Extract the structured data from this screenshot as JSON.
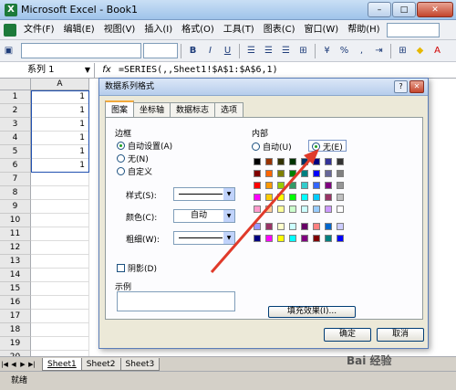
{
  "window": {
    "title": "Microsoft Excel - Book1",
    "logo": "X",
    "buttons": [
      "–",
      "□",
      "✕"
    ]
  },
  "menu": {
    "items": [
      "文件(F)",
      "编辑(E)",
      "视图(V)",
      "插入(I)",
      "格式(O)",
      "工具(T)",
      "图表(C)",
      "窗口(W)",
      "帮助(H)"
    ]
  },
  "toolbar": {
    "icons": [
      "save-icon",
      "bold-icon",
      "italic-icon",
      "underline-icon",
      "align-left-icon",
      "align-center-icon",
      "align-right-icon",
      "merge-icon",
      "currency-icon",
      "percent-icon",
      "comma-icon",
      "indent-icon",
      "border-icon",
      "fill-color-icon",
      "font-color-icon"
    ],
    "labels": [
      "B",
      "I",
      "U"
    ]
  },
  "formula_bar": {
    "name_box": "系列 1",
    "fx": "fx",
    "formula": "=SERIES(,,Sheet1!$A$1:$A$6,1)"
  },
  "sheet": {
    "column": "A",
    "rows": [
      {
        "n": "1",
        "a": "1"
      },
      {
        "n": "2",
        "a": "1"
      },
      {
        "n": "3",
        "a": "1"
      },
      {
        "n": "4",
        "a": "1"
      },
      {
        "n": "5",
        "a": "1"
      },
      {
        "n": "6",
        "a": "1"
      },
      {
        "n": "7",
        "a": ""
      },
      {
        "n": "8",
        "a": ""
      },
      {
        "n": "9",
        "a": ""
      },
      {
        "n": "10",
        "a": ""
      },
      {
        "n": "11",
        "a": ""
      },
      {
        "n": "12",
        "a": ""
      },
      {
        "n": "13",
        "a": ""
      },
      {
        "n": "14",
        "a": ""
      },
      {
        "n": "15",
        "a": ""
      },
      {
        "n": "16",
        "a": ""
      },
      {
        "n": "17",
        "a": ""
      },
      {
        "n": "18",
        "a": ""
      },
      {
        "n": "19",
        "a": ""
      },
      {
        "n": "20",
        "a": ""
      }
    ]
  },
  "sheet_tabs": [
    "Sheet1",
    "Sheet2",
    "Sheet3"
  ],
  "status": "就绪",
  "dialog": {
    "title": "数据系列格式",
    "help": "?",
    "close": "✕",
    "tabs": [
      "图案",
      "坐标轴",
      "数据标志",
      "选项"
    ],
    "border": {
      "label": "边框",
      "options": [
        "自动设置(A)",
        "无(N)",
        "自定义"
      ],
      "style_label": "样式(S):",
      "color_label": "颜色(C):",
      "color_value": "自动",
      "weight_label": "粗细(W):",
      "shadow_label": "阴影(D)",
      "sample_label": "示例"
    },
    "area": {
      "label": "内部",
      "options": [
        "自动(U)",
        "无(E)"
      ],
      "fill_button": "填充效果(I)..."
    },
    "ok": "确定",
    "cancel": "取消"
  },
  "palette": [
    "#000000",
    "#993300",
    "#333300",
    "#003300",
    "#003366",
    "#000080",
    "#333399",
    "#333333",
    "#800000",
    "#ff6600",
    "#808000",
    "#008000",
    "#008080",
    "#0000ff",
    "#666699",
    "#808080",
    "#ff0000",
    "#ff9900",
    "#99cc00",
    "#339966",
    "#33cccc",
    "#3366ff",
    "#800080",
    "#969696",
    "#ff00ff",
    "#ffcc00",
    "#ffff00",
    "#00ff00",
    "#00ffff",
    "#00ccff",
    "#993366",
    "#c0c0c0",
    "#ff99cc",
    "#ffcc99",
    "#ffff99",
    "#ccffcc",
    "#ccffff",
    "#99ccff",
    "#cc99ff",
    "#ffffff",
    "#9999ff",
    "#993366",
    "#ffffcc",
    "#ccffff",
    "#660066",
    "#ff8080",
    "#0066cc",
    "#ccccff",
    "#000080",
    "#ff00ff",
    "#ffff00",
    "#00ffff",
    "#800080",
    "#800000",
    "#008080",
    "#0000ff"
  ],
  "watermark": "Bai 经验"
}
